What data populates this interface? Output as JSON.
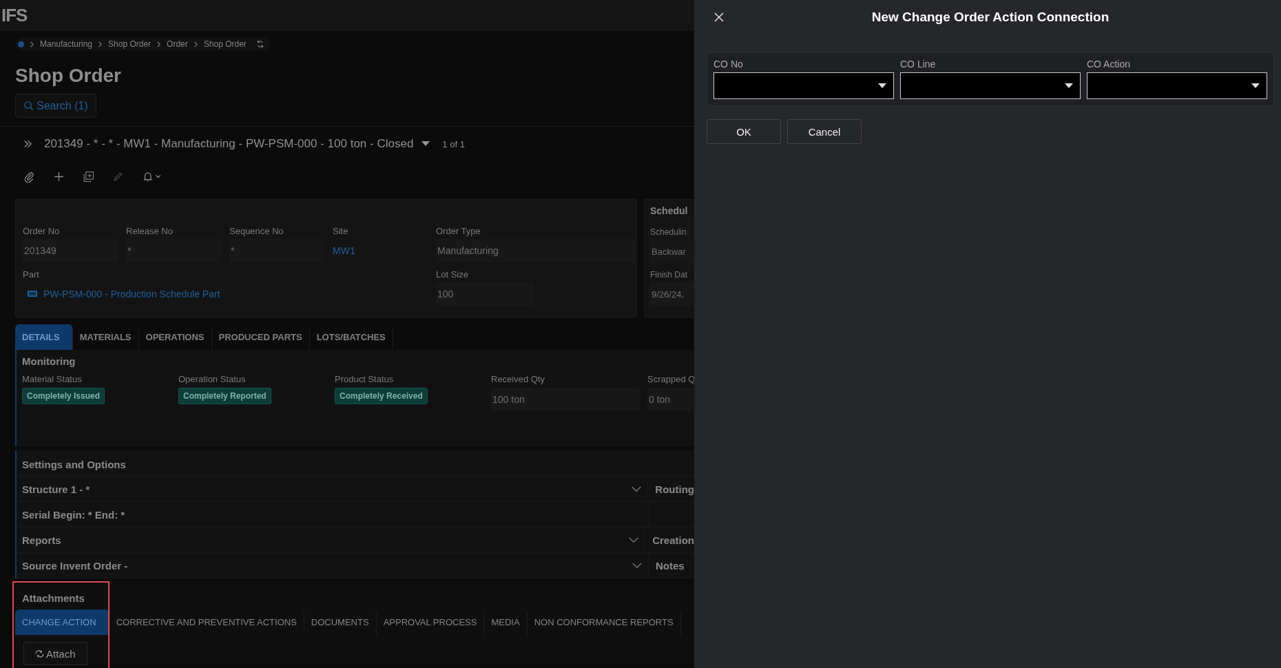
{
  "app": {
    "logo": "IFS"
  },
  "breadcrumb": [
    "Manufacturing",
    "Shop Order",
    "Order",
    "Shop Order"
  ],
  "page": {
    "title": "Shop Order",
    "search_button": "Search (1)"
  },
  "record": {
    "title": "201349 - * - * - MW1 - Manufacturing - PW-PSM-000 - 100 ton - Closed",
    "counter": "1 of 1"
  },
  "header_fields": [
    {
      "label": "Order No",
      "value": "201349",
      "kind": "field"
    },
    {
      "label": "Release No",
      "value": "*",
      "kind": "field"
    },
    {
      "label": "Sequence No",
      "value": "*",
      "kind": "field"
    },
    {
      "label": "Site",
      "value": "MW1",
      "kind": "link"
    },
    {
      "label": "Order Type",
      "value": "Manufacturing",
      "kind": "field"
    },
    {
      "label": "Part",
      "value": "PW-PSM-000 - Production Schedule Part",
      "kind": "part_link"
    },
    {
      "label": "Lot Size",
      "value": "100",
      "kind": "short_field"
    }
  ],
  "schedule_card": {
    "title": "Schedul",
    "fields": [
      {
        "label": "Schedulin",
        "value": "Backwar"
      },
      {
        "label": "Finish Dat",
        "value": "9/26/24,"
      }
    ]
  },
  "tabs": [
    {
      "label": "DETAILS",
      "selected": true
    },
    {
      "label": "MATERIALS",
      "selected": false
    },
    {
      "label": "OPERATIONS",
      "selected": false
    },
    {
      "label": "PRODUCED PARTS",
      "selected": false
    },
    {
      "label": "LOTS/BATCHES",
      "selected": false
    }
  ],
  "monitoring": {
    "title": "Monitoring",
    "items": [
      {
        "label": "Material Status",
        "value": "Completely Issued",
        "kind": "badge"
      },
      {
        "label": "Operation Status",
        "value": "Completely Reported",
        "kind": "badge"
      },
      {
        "label": "Product Status",
        "value": "Completely Received",
        "kind": "badge"
      },
      {
        "label": "Received Qty",
        "value": "100 ton",
        "kind": "field"
      },
      {
        "label": "Scrapped Q",
        "value": "0 ton",
        "kind": "field"
      }
    ]
  },
  "settings": {
    "title": "Settings and Options",
    "rows": [
      {
        "label": "Structure 1 - *",
        "kind": "collapsible",
        "side": "Routing"
      },
      {
        "label": "Serial Begin: * End: *",
        "kind": "text"
      },
      {
        "label": "Reports",
        "kind": "collapsible",
        "side": "Creation"
      },
      {
        "label": "Source Invent Order -",
        "kind": "collapsible",
        "side": "Notes"
      }
    ]
  },
  "attachments": {
    "title": "Attachments",
    "highlighted": true,
    "tabs": [
      {
        "label": "CHANGE ACTION",
        "selected": true
      },
      {
        "label": "CORRECTIVE AND PREVENTIVE ACTIONS",
        "selected": false
      },
      {
        "label": "DOCUMENTS",
        "selected": false
      },
      {
        "label": "APPROVAL PROCESS",
        "selected": false
      },
      {
        "label": "MEDIA",
        "selected": false
      },
      {
        "label": "NON CONFORMANCE REPORTS",
        "selected": false
      }
    ],
    "attach_button": "Attach"
  },
  "dialog": {
    "title": "New Change Order Action Connection",
    "fields": [
      {
        "label": "CO No"
      },
      {
        "label": "CO Line"
      },
      {
        "label": "CO Action"
      }
    ],
    "buttons": [
      "OK",
      "Cancel"
    ]
  }
}
